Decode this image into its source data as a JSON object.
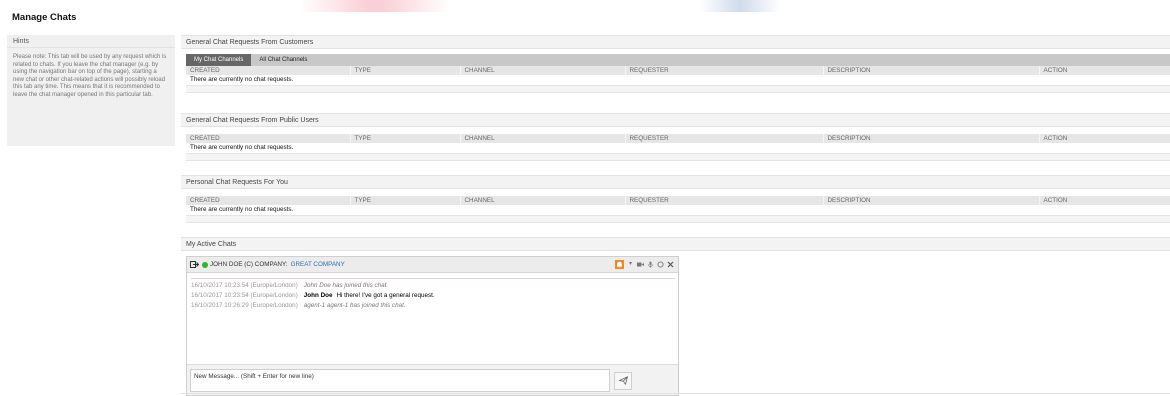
{
  "page": {
    "title": "Manage Chats"
  },
  "hints": {
    "header": "Hints",
    "text": "Please note: This tab will be used by any request which is related to chats. If you leave the chat manager (e.g. by using the navigation bar on top of the page), starting a new chat or other chat-related actions will possibly reload this tab any time. This means that it is recommended to leave the chat manager opened in this particular tab."
  },
  "columns": {
    "created": "CREATED",
    "type": "TYPE",
    "channel": "CHANNEL",
    "requester": "REQUESTER",
    "description": "DESCRIPTION",
    "action": "ACTION"
  },
  "sections": {
    "customers": {
      "header": "General Chat Requests From Customers",
      "tabs": [
        "My Chat Channels",
        "All Chat Channels"
      ],
      "empty": "There are currently no chat requests."
    },
    "public": {
      "header": "General Chat Requests From Public Users",
      "empty": "There are currently no chat requests."
    },
    "personal": {
      "header": "Personal Chat Requests For You",
      "empty": "There are currently no chat requests."
    },
    "active": {
      "header": "My Active Chats"
    }
  },
  "chat": {
    "participant": "JOHN DOE (C) COMPANY:",
    "company": "GREAT COMPANY",
    "status_color": "#2cb62c",
    "messages": [
      {
        "time": "16/10/2017 10:23:54 (Europe/London)",
        "author": "",
        "text": "John Doe has joined this chat.",
        "system": true
      },
      {
        "time": "16/10/2017 10:23:54 (Europe/London)",
        "author": "John Doe",
        "text": "Hi there! I've got a general request.",
        "system": false
      },
      {
        "time": "16/10/2017 10:26:29 (Europe/London)",
        "author": "",
        "text": "agent-1 agent-1 has joined this chat.",
        "system": true
      }
    ],
    "input_placeholder": "New Message... (Shift + Enter for new line)"
  }
}
